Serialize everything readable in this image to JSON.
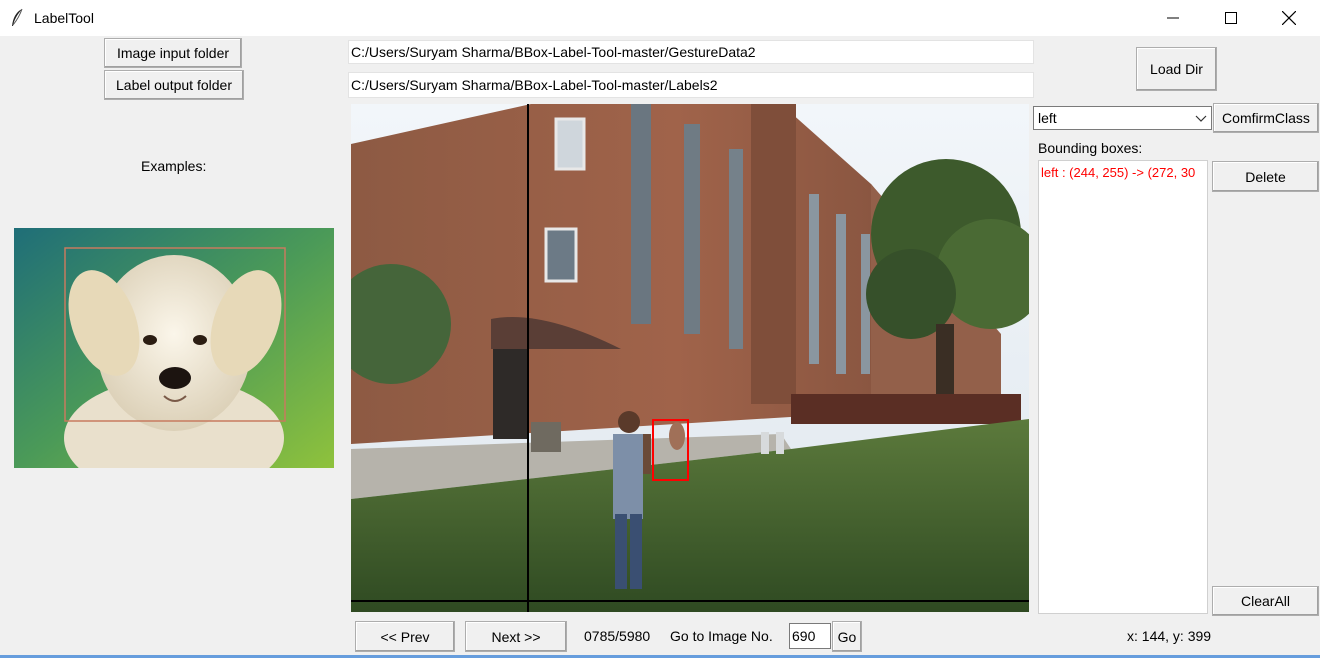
{
  "window": {
    "title": "LabelTool",
    "icon": "feather-icon",
    "controls": [
      "minimize-icon",
      "maximize-icon",
      "close-icon"
    ]
  },
  "left_panel": {
    "image_input_button": "Image input folder",
    "label_output_button": "Label output folder",
    "examples_label": "Examples:"
  },
  "paths": {
    "image_dir": "C:/Users/Suryam Sharma/BBox-Label-Tool-master/GestureData2",
    "label_dir": "C:/Users/Suryam Sharma/BBox-Label-Tool-master/Labels2"
  },
  "right_panel": {
    "load_dir_button": "Load Dir",
    "class_selected": "left",
    "confirm_class_button": "ComfirmClass",
    "bbox_label": "Bounding boxes:",
    "bboxes": [
      "left : (244, 255) -> (272, 30"
    ],
    "delete_button": "Delete",
    "clear_all_button": "ClearAll"
  },
  "navigation": {
    "prev_button": "<< Prev",
    "next_button": ">> ",
    "next_label": "Next >>",
    "progress": "0785/5980",
    "goto_label": "Go to Image No.",
    "goto_value": "690",
    "go_button": "Go",
    "cursor_position": "x: 144, y: 399"
  },
  "colors": {
    "bbox": "#ff0000",
    "listbox_text": "#ff0000",
    "example_bbox": "#c77b5f"
  }
}
